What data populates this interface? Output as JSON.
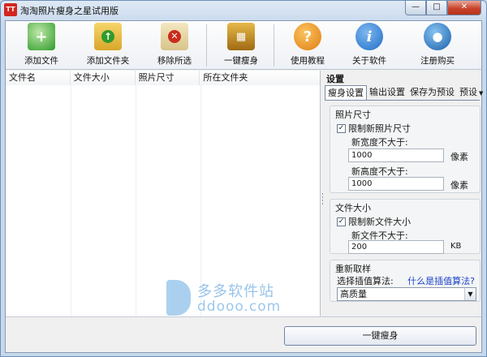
{
  "window": {
    "title": "淘淘照片瘦身之星试用版",
    "app_icon": "tt-logo-icon"
  },
  "toolbar": {
    "items": [
      {
        "label": "添加文件",
        "icon": "add-file-icon",
        "color": "#2f9b2a"
      },
      {
        "label": "添加文件夹",
        "icon": "add-folder-icon",
        "color": "#3a9a2a"
      },
      {
        "label": "移除所选",
        "icon": "remove-icon",
        "color": "#c92b1d"
      },
      {
        "label": "一键瘦身",
        "icon": "slim-icon",
        "color": "#c08c22"
      },
      {
        "label": "使用教程",
        "icon": "help-icon",
        "color": "#e07d12"
      },
      {
        "label": "关于软件",
        "icon": "info-icon",
        "color": "#1f6fc6"
      },
      {
        "label": "注册购买",
        "icon": "globe-icon",
        "color": "#1a5ea8"
      }
    ]
  },
  "table": {
    "columns": [
      "文件名",
      "文件大小",
      "照片尺寸",
      "所在文件夹"
    ]
  },
  "settings": {
    "title": "设置",
    "tabs": [
      "瘦身设置",
      "输出设置",
      "保存为预设",
      "预设"
    ],
    "photo_size": {
      "title": "照片尺寸",
      "limit_label": "限制新照片尺寸",
      "limit_checked": true,
      "width_label": "新宽度不大于:",
      "width_value": "1000",
      "height_label": "新高度不大于:",
      "height_value": "1000",
      "unit": "像素"
    },
    "file_size": {
      "title": "文件大小",
      "limit_label": "限制新文件大小",
      "limit_checked": true,
      "size_label": "新文件不大于:",
      "size_value": "200",
      "unit": "KB"
    },
    "resample": {
      "title": "重新取样",
      "algo_label": "选择插值算法:",
      "help_link": "什么是插值算法?",
      "selected": "高质量"
    }
  },
  "bottom": {
    "go_label": "一键瘦身"
  },
  "watermark": {
    "cn": "多多软件站",
    "en": "ddooo.com"
  }
}
